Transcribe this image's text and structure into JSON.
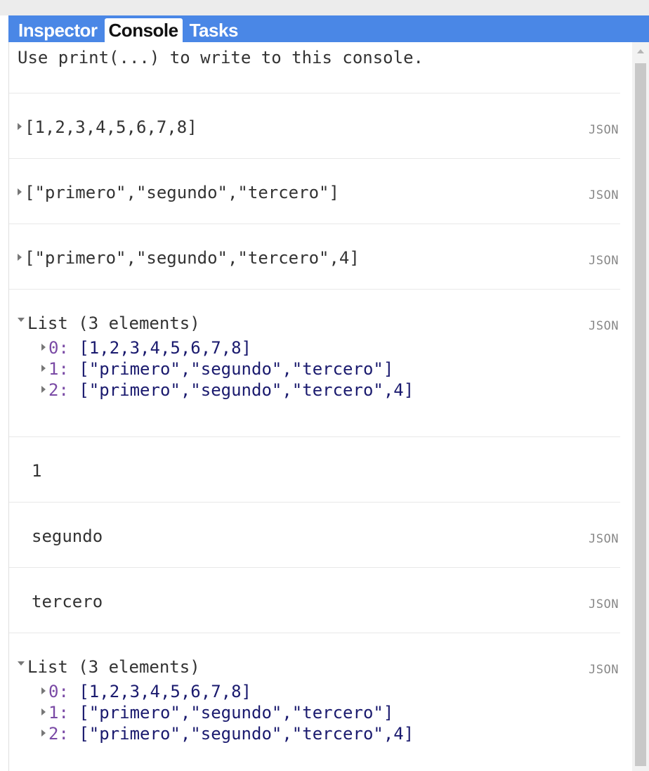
{
  "tabs": [
    {
      "label": "Inspector",
      "active": false
    },
    {
      "label": "Console",
      "active": true
    },
    {
      "label": "Tasks",
      "active": false
    }
  ],
  "console": {
    "intro": "Use print(...) to write to this console.",
    "json_label": "JSON",
    "entries": [
      {
        "type": "collapsed",
        "text": "[1,2,3,4,5,6,7,8]"
      },
      {
        "type": "collapsed",
        "text": "[\"primero\",\"segundo\",\"tercero\"]"
      },
      {
        "type": "collapsed",
        "text": "[\"primero\",\"segundo\",\"tercero\",4]"
      },
      {
        "type": "list",
        "header": "List (3 elements)",
        "children": [
          {
            "key": "0:",
            "value": "[1,2,3,4,5,6,7,8]"
          },
          {
            "key": "1:",
            "value": "[\"primero\",\"segundo\",\"tercero\"]"
          },
          {
            "key": "2:",
            "value": "[\"primero\",\"segundo\",\"tercero\",4]"
          }
        ]
      },
      {
        "type": "plain",
        "text": "1"
      },
      {
        "type": "plain",
        "text": "segundo"
      },
      {
        "type": "plain",
        "text": "tercero"
      },
      {
        "type": "list",
        "header": "List (3 elements)",
        "children": [
          {
            "key": "0:",
            "value": "[1,2,3,4,5,6,7,8]"
          },
          {
            "key": "1:",
            "value": "[\"primero\",\"segundo\",\"tercero\"]"
          },
          {
            "key": "2:",
            "value": "[\"primero\",\"segundo\",\"tercero\",4]"
          }
        ]
      }
    ]
  },
  "colors": {
    "tab_bar": "#4a87e6",
    "text": "#333333",
    "json_link": "#888888"
  }
}
